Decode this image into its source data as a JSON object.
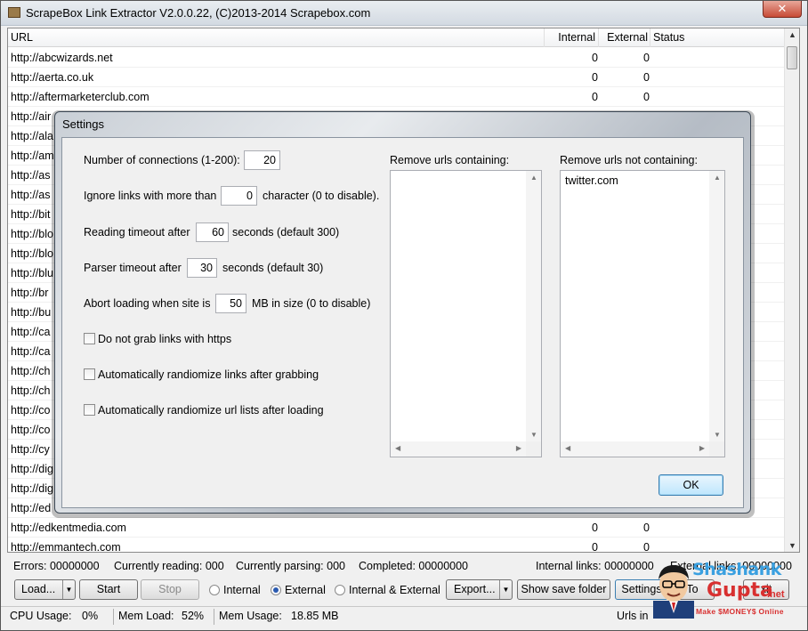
{
  "window": {
    "title": "ScrapeBox Link Extractor V2.0.0.22, (C)2013-2014 Scrapebox.com",
    "close_glyph": "✕"
  },
  "list": {
    "columns": [
      "URL",
      "Internal",
      "External",
      "Status"
    ],
    "rows": [
      {
        "url": "http://abcwizards.net",
        "internal": "0",
        "external": "0"
      },
      {
        "url": "http://aerta.co.uk",
        "internal": "0",
        "external": "0"
      },
      {
        "url": "http://aftermarketerclub.com",
        "internal": "0",
        "external": "0"
      },
      {
        "url": "http://air",
        "internal": "",
        "external": ""
      },
      {
        "url": "http://ala",
        "internal": "",
        "external": ""
      },
      {
        "url": "http://am",
        "internal": "",
        "external": ""
      },
      {
        "url": "http://as",
        "internal": "",
        "external": ""
      },
      {
        "url": "http://as",
        "internal": "",
        "external": ""
      },
      {
        "url": "http://bit",
        "internal": "",
        "external": ""
      },
      {
        "url": "http://blo",
        "internal": "",
        "external": ""
      },
      {
        "url": "http://blo",
        "internal": "",
        "external": ""
      },
      {
        "url": "http://blu",
        "internal": "",
        "external": ""
      },
      {
        "url": "http://br",
        "internal": "",
        "external": ""
      },
      {
        "url": "http://bu",
        "internal": "",
        "external": ""
      },
      {
        "url": "http://ca",
        "internal": "",
        "external": ""
      },
      {
        "url": "http://ca",
        "internal": "",
        "external": ""
      },
      {
        "url": "http://ch",
        "internal": "",
        "external": ""
      },
      {
        "url": "http://ch",
        "internal": "",
        "external": ""
      },
      {
        "url": "http://co",
        "internal": "",
        "external": ""
      },
      {
        "url": "http://co",
        "internal": "",
        "external": ""
      },
      {
        "url": "http://cy",
        "internal": "",
        "external": ""
      },
      {
        "url": "http://dig",
        "internal": "",
        "external": ""
      },
      {
        "url": "http://dig",
        "internal": "",
        "external": ""
      },
      {
        "url": "http://ed",
        "internal": "",
        "external": ""
      },
      {
        "url": "http://edkentmedia.com",
        "internal": "0",
        "external": "0"
      },
      {
        "url": "http://emmantech.com",
        "internal": "0",
        "external": "0"
      }
    ]
  },
  "status": {
    "errors": "Errors:  00000000",
    "reading": "Currently reading:  000",
    "parsing": "Currently parsing:  000",
    "completed": "Completed:  00000000",
    "internal_links": "Internal links:  00000000",
    "external_links": "External links:  00000000"
  },
  "toolbar": {
    "load": "Load...",
    "start": "Start",
    "stop": "Stop",
    "radio_internal": "Internal",
    "radio_external": "External",
    "radio_both": "Internal & External",
    "selected": "External",
    "export": "Export...",
    "show_save_folder": "Show save folder",
    "settings": "Settings",
    "to": "To",
    "exit": "xit"
  },
  "statusbar": {
    "cpu": "CPU Usage:",
    "cpu_val": "0%",
    "memload": "Mem Load:",
    "memload_val": "52%",
    "memusage": "Mem Usage:",
    "memusage_val": "18.85 MB",
    "urls": "Urls in"
  },
  "dialog": {
    "title": "Settings",
    "connections_label": "Number of connections (1-200):",
    "connections_value": "20",
    "ignore_label": "Ignore links with more than",
    "ignore_value": "0",
    "ignore_suffix": "character (0 to disable).",
    "reading_label": "Reading timeout after",
    "reading_value": "60",
    "reading_suffix": "seconds (default 300)",
    "parser_label": "Parser timeout after",
    "parser_value": "30",
    "parser_suffix": "seconds (default 30)",
    "abort_label": "Abort loading when site is",
    "abort_value": "50",
    "abort_suffix": "MB in size (0 to disable)",
    "cb_https": "Do not grab links with https",
    "cb_random_links": "Automatically randiomize links after grabbing",
    "cb_random_urls": "Automatically randiomize url lists after loading",
    "remove_containing": "Remove urls containing:",
    "remove_not_containing": "Remove urls not containing:",
    "remove_not_containing_text": "twitter.com",
    "ok": "OK"
  },
  "watermark": {
    "name_top": "Shashank",
    "name_bottom": "Gupta",
    "net": ".net",
    "tagline": "Make $MONEY$ Online"
  }
}
